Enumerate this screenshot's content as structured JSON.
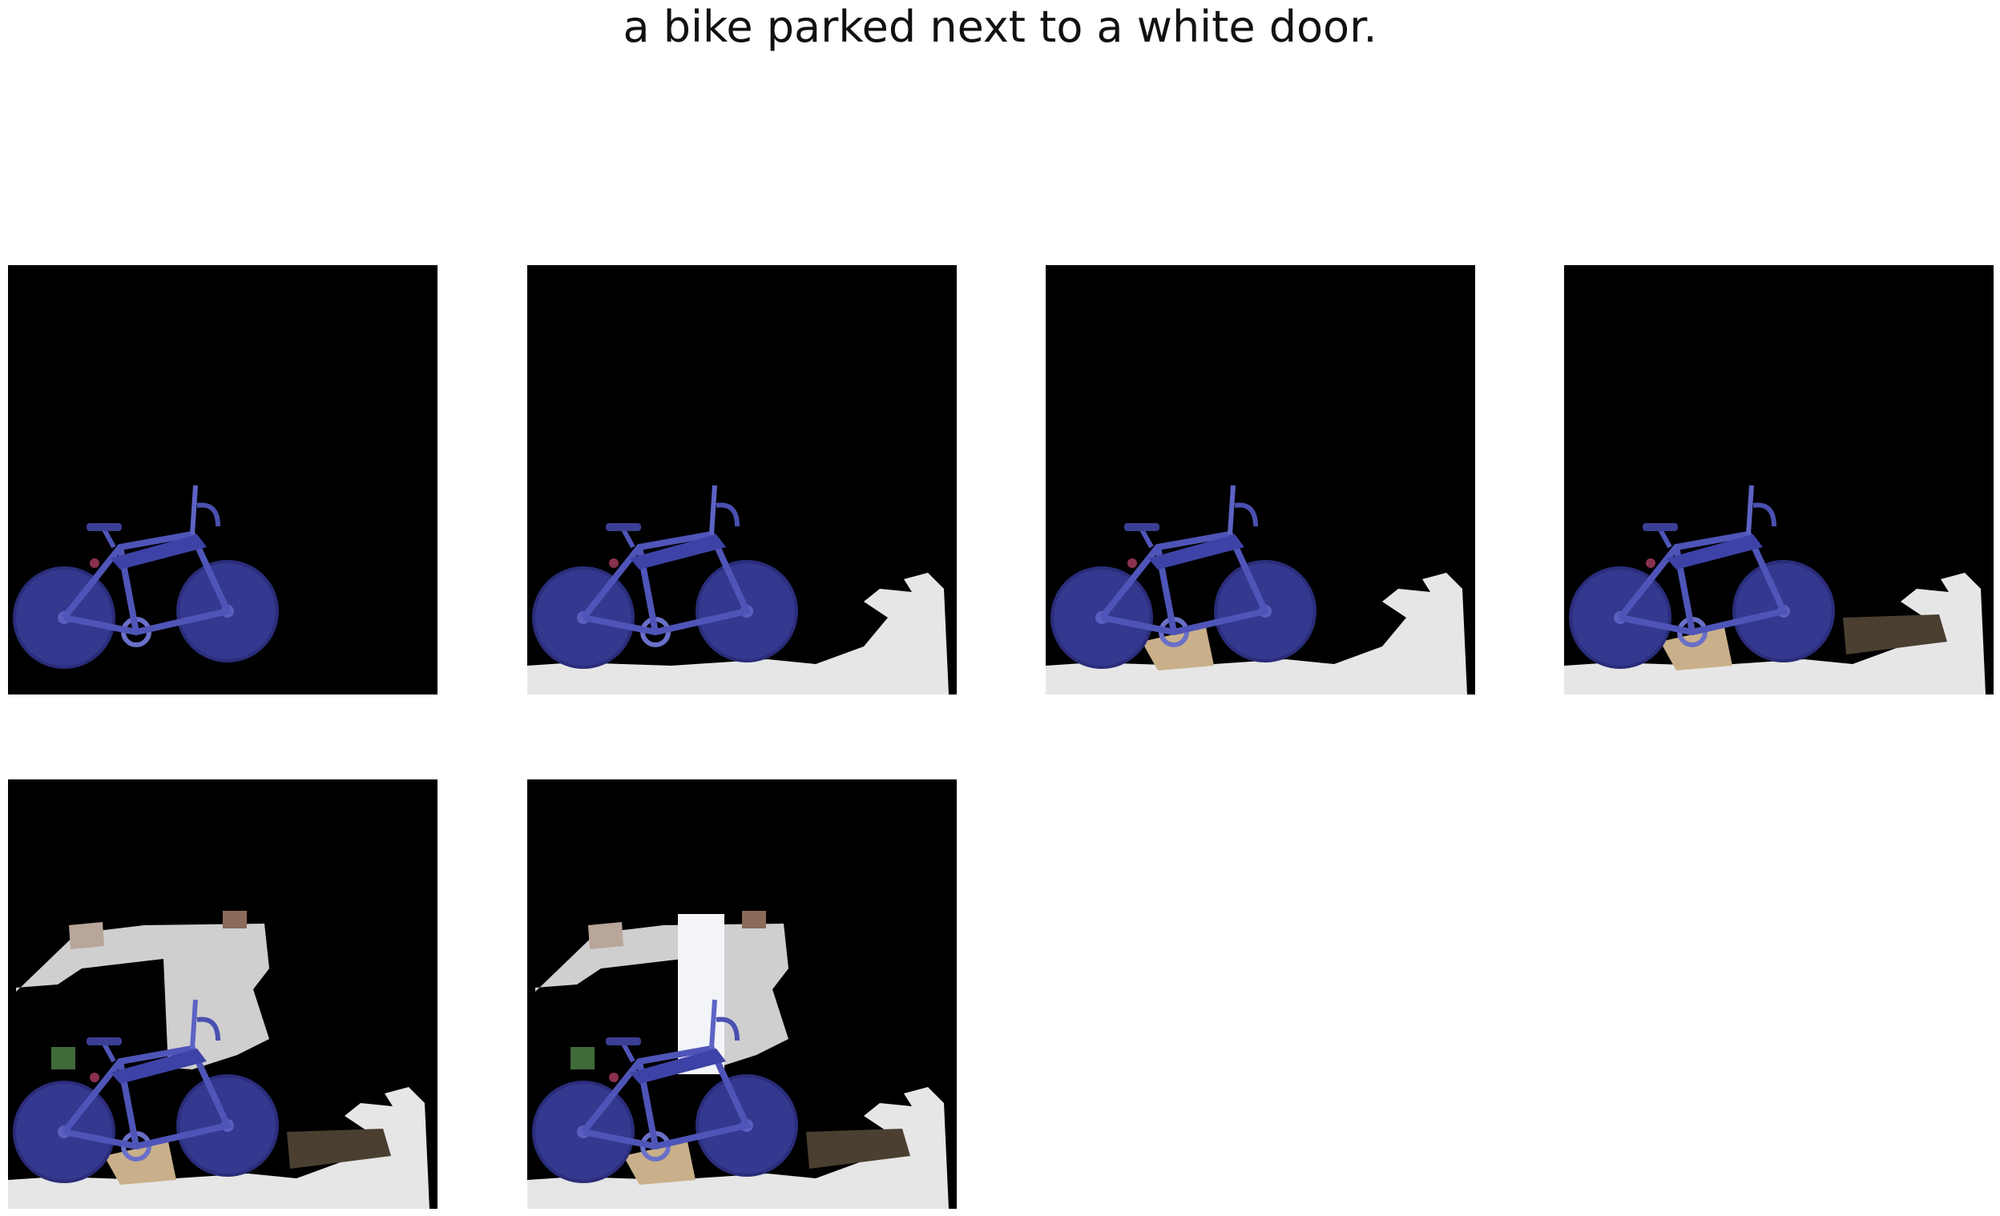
{
  "caption": "a bike parked next to a white door.",
  "panels": [
    {
      "step": 1,
      "revealed": [
        "bike"
      ]
    },
    {
      "step": 2,
      "revealed": [
        "bike",
        "floor"
      ]
    },
    {
      "step": 3,
      "revealed": [
        "bike",
        "floor",
        "rug"
      ]
    },
    {
      "step": 4,
      "revealed": [
        "bike",
        "floor",
        "rug",
        "bench"
      ]
    },
    {
      "step": 5,
      "revealed": [
        "bike",
        "floor",
        "rug",
        "bench",
        "wall",
        "shelf"
      ]
    },
    {
      "step": 6,
      "revealed": [
        "bike",
        "floor",
        "rug",
        "bench",
        "wall",
        "shelf",
        "door"
      ]
    }
  ],
  "colors": {
    "background": "#ffffff",
    "mask": "#000000",
    "bike": "#3a3f9a",
    "floor": "#e6e6e6",
    "wall": "#cfcfcf",
    "bench": "#4a3f30",
    "rug": "#c9b08a",
    "door": "#f2f4f8"
  }
}
